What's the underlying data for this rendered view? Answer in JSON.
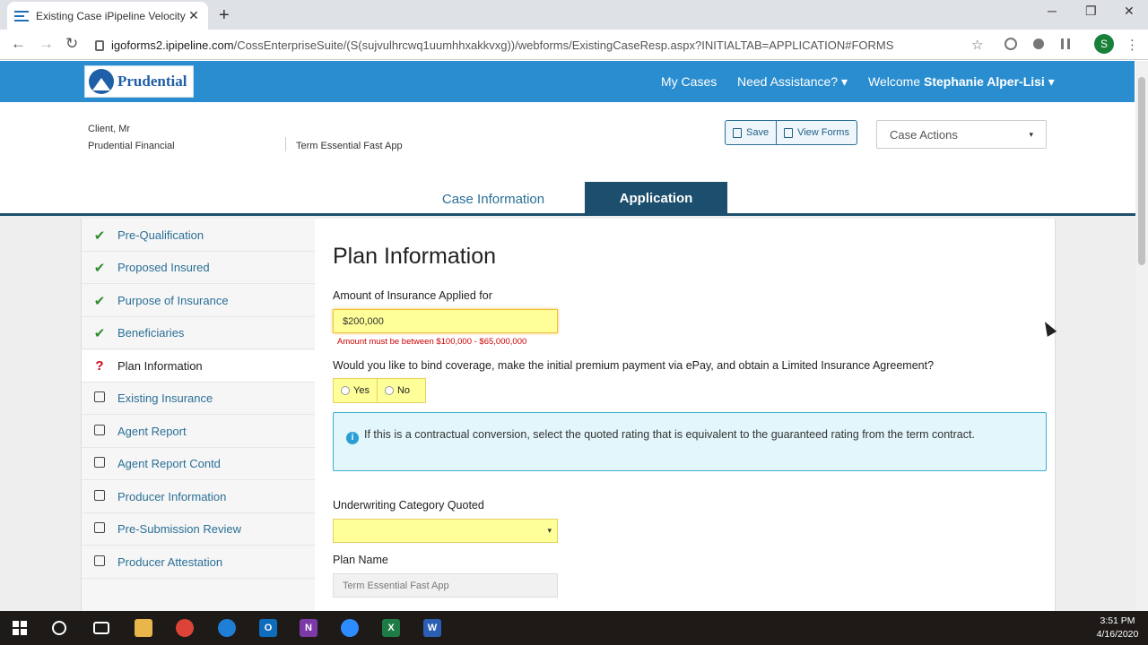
{
  "browser": {
    "tab_title": "Existing Case iPipeline Velocity P",
    "tab_close": "✕",
    "new_tab": "+",
    "url_host": "igoforms2.ipipeline.com",
    "url_path": "/CossEnterpriseSuite/(S(sujvulhrcwq1uumhhxakkvxg))/webforms/ExistingCaseResp.aspx?INITIALTAB=APPLICATION#FORMS",
    "profile_initial": "S",
    "icons": {
      "minimize": "─",
      "restore": "❐",
      "close": "✕",
      "back": "←",
      "forward": "→",
      "reload": "↻",
      "star": "☆",
      "menu": "⋮"
    }
  },
  "header": {
    "logo_text": "Prudential",
    "my_cases": "My Cases",
    "need_assistance": "Need Assistance? ▾",
    "welcome_prefix": "Welcome",
    "user_name": "Stephanie Alper-Lisi ▾"
  },
  "case": {
    "client": "Client, Mr",
    "company": "Prudential Financial",
    "product": "Term Essential Fast App",
    "save_label": "Save",
    "view_forms_label": "View Forms",
    "case_actions": "Case Actions",
    "caret": "▾"
  },
  "tabs": {
    "case_information": "Case Information",
    "application": "Application"
  },
  "sidebar": {
    "items": [
      {
        "label": "Pre-Qualification",
        "status": "complete",
        "mark": "✔"
      },
      {
        "label": "Proposed Insured",
        "status": "complete",
        "mark": "✔"
      },
      {
        "label": "Purpose of Insurance",
        "status": "complete",
        "mark": "✔"
      },
      {
        "label": "Beneficiaries",
        "status": "complete",
        "mark": "✔"
      },
      {
        "label": "Plan Information",
        "status": "current",
        "mark": "?"
      },
      {
        "label": "Existing Insurance",
        "status": "incomplete"
      },
      {
        "label": "Agent Report",
        "status": "incomplete"
      },
      {
        "label": "Agent Report Contd",
        "status": "incomplete"
      },
      {
        "label": "Producer Information",
        "status": "incomplete"
      },
      {
        "label": "Pre-Submission Review",
        "status": "incomplete"
      },
      {
        "label": "Producer Attestation",
        "status": "incomplete"
      }
    ]
  },
  "form": {
    "title": "Plan Information",
    "amount_label": "Amount of Insurance Applied for",
    "amount_value": "$200,000",
    "amount_error": "Amount must be between $100,000 - $65,000,000",
    "bind_question": "Would you like to bind coverage, make the initial premium payment via ePay, and obtain a Limited Insurance Agreement?",
    "yes": "Yes",
    "no": "No",
    "info_icon": "i",
    "info_text": "If this is a contractual conversion, select the quoted rating that is equivalent to the guaranteed rating from the term contract.",
    "uw_label": "Underwriting Category Quoted",
    "select_caret": "▾",
    "plan_name_label": "Plan Name",
    "plan_name_value": "Term Essential Fast App"
  },
  "taskbar": {
    "time": "3:51 PM",
    "date": "4/16/2020",
    "letters": {
      "outlook": "O",
      "onenote": "N",
      "excel": "X",
      "word": "W"
    }
  },
  "colors": {
    "header_blue": "#2a8dcf",
    "tab_active": "#1c4e6d",
    "link_blue": "#2a6f97",
    "check_green": "#2f8f2f",
    "error_red": "#cc0000",
    "highlight_yellow": "#ffff99"
  }
}
